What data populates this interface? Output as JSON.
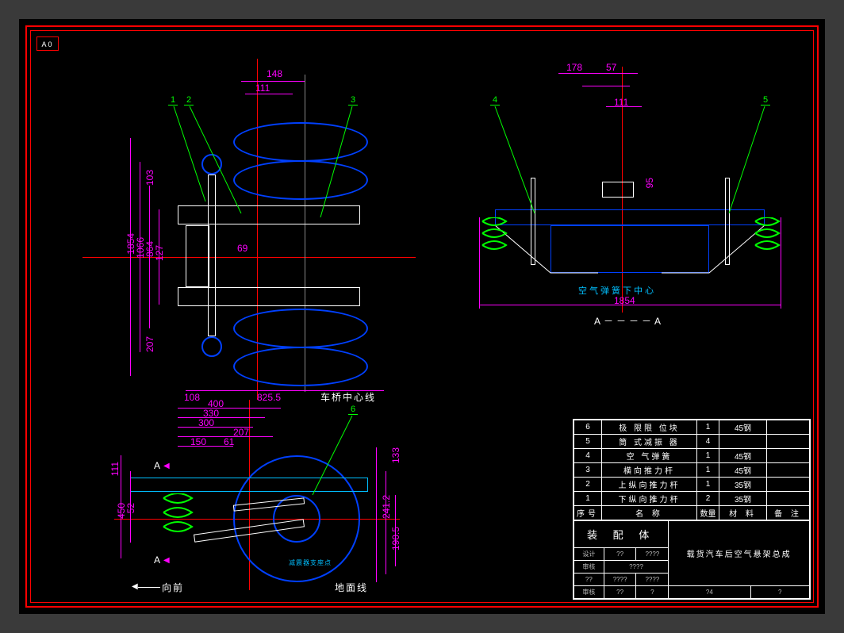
{
  "corner_tag": "A0",
  "top_view": {
    "dims_h": {
      "d148": "148",
      "d111": "111",
      "d108": "108",
      "d825_5": "825.5",
      "d69": "69"
    },
    "dims_v": {
      "d1854": "1854",
      "d1066": "1066",
      "d864": "864",
      "d127": "127",
      "d103": "103",
      "d207": "207"
    },
    "axis_label": "车桥中心线",
    "balloons": {
      "b1": "1",
      "b2": "2",
      "b3": "3"
    }
  },
  "section_view": {
    "dims_h": {
      "d178": "178",
      "d57": "57",
      "d111": "111",
      "d1854b": "1854"
    },
    "dims_v": {
      "d95": "95"
    },
    "center_label": "空气弹簧下中心",
    "section_label": "A－－－－A",
    "balloons": {
      "b4": "4",
      "b5": "5"
    }
  },
  "side_view": {
    "dims_h": {
      "d400": "400",
      "d330": "330",
      "d300": "300",
      "d207": "207",
      "d150": "150",
      "d61": "61"
    },
    "dims_v": {
      "d111": "111",
      "d450": "450",
      "d52": "52",
      "d133": "133",
      "d241_2": "241.2",
      "d190_5": "190.5"
    },
    "section_mark_top": "A",
    "section_mark_bot": "A",
    "forward_label": "向前",
    "ground_label": "地面线",
    "small_label": "减震器支座点",
    "balloons": {
      "b6": "6"
    }
  },
  "bom": {
    "rows": [
      {
        "no": "6",
        "name": "极 限限 位块",
        "qty": "1",
        "mat": "45钢",
        "note": ""
      },
      {
        "no": "5",
        "name": "筒 式减振 器",
        "qty": "4",
        "mat": "",
        "note": ""
      },
      {
        "no": "4",
        "name": "空 气弹簧",
        "qty": "1",
        "mat": "45钢",
        "note": ""
      },
      {
        "no": "3",
        "name": "横向推力杆",
        "qty": "1",
        "mat": "45钢",
        "note": ""
      },
      {
        "no": "2",
        "name": "上纵向推力杆",
        "qty": "1",
        "mat": "35钢",
        "note": ""
      },
      {
        "no": "1",
        "name": "下纵向推力杆",
        "qty": "2",
        "mat": "35钢",
        "note": ""
      }
    ],
    "header": {
      "no": "序号",
      "name": "名    称",
      "qty": "数量",
      "mat": "材    料",
      "note": "备  注"
    },
    "assy_label": "装 配 体",
    "drawing_title": "载货汽车后空气悬架总成",
    "lower": {
      "r1c1": "设计",
      "r1c2": "??",
      "r1c3": "????",
      "r1c4": "? ?????",
      "r2c1": "审核",
      "r2c2": "????",
      "r3c1": "??",
      "r3c2": "????",
      "r3c3": "????",
      "r3c4": "?4",
      "r4c1": "审核",
      "r4c2": "??",
      "r4c3": "?",
      "r4c4": "?"
    }
  }
}
